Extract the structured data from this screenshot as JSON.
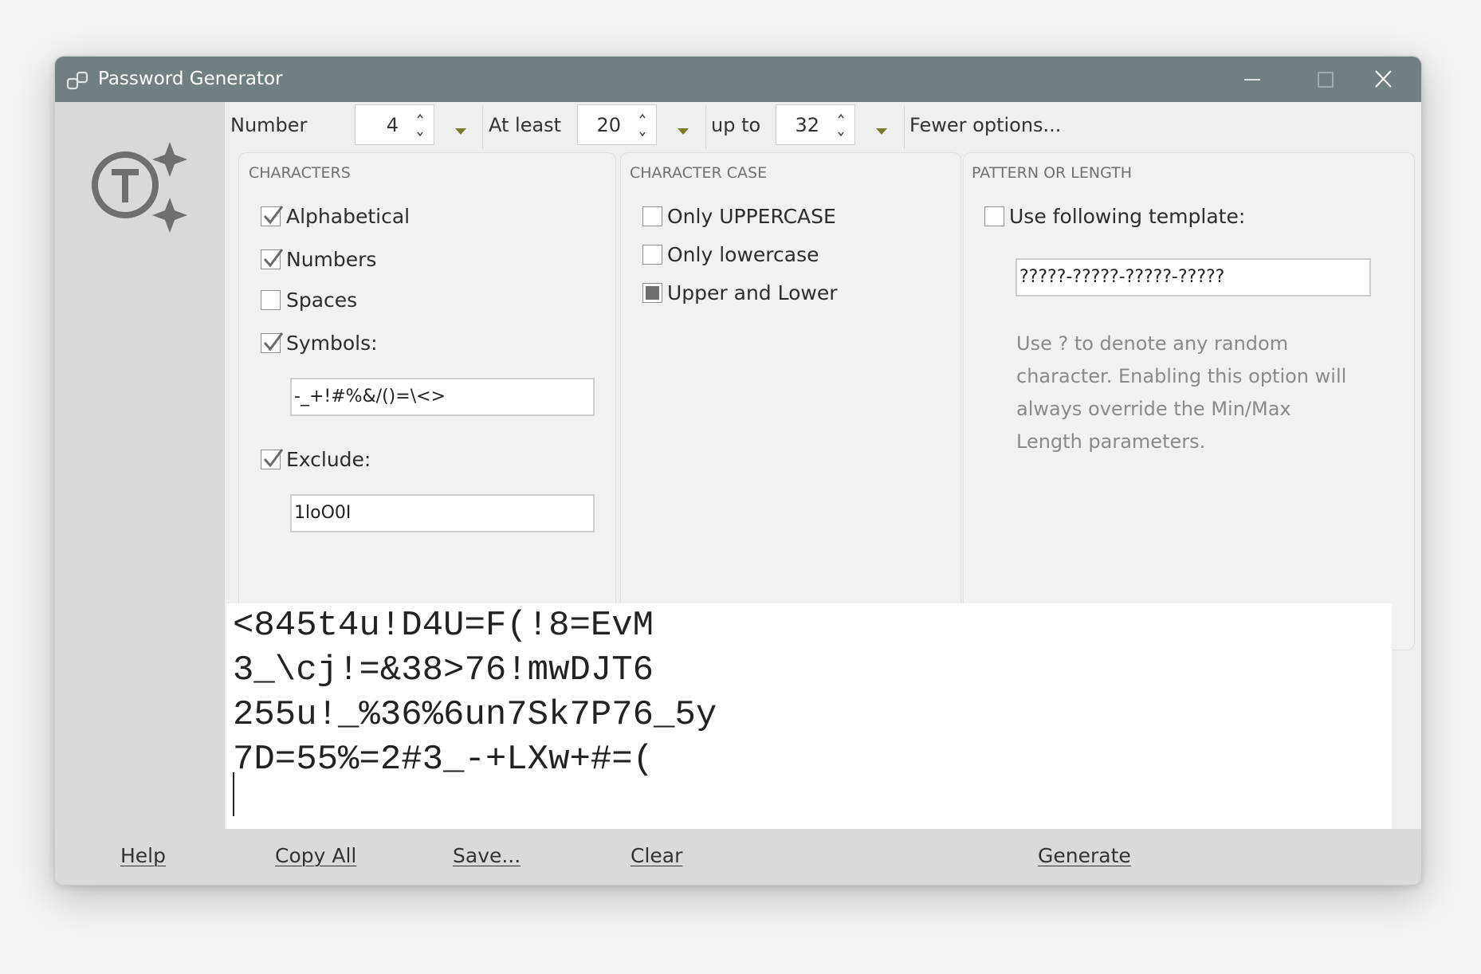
{
  "window": {
    "title": "Password Generator"
  },
  "toolbar": {
    "number_label": "Number",
    "number_value": "4",
    "at_least_label": "At least",
    "at_least_value": "20",
    "up_to_label": "up to",
    "up_to_value": "32",
    "fewer_options_label": "Fewer options..."
  },
  "characters": {
    "title": "CHARACTERS",
    "alphabetical": {
      "label": "Alphabetical",
      "checked": true
    },
    "numbers": {
      "label": "Numbers",
      "checked": true
    },
    "spaces": {
      "label": "Spaces",
      "checked": false
    },
    "symbols": {
      "label": "Symbols:",
      "checked": true,
      "value": "-_+!#%&/()=\\<>"
    },
    "exclude": {
      "label": "Exclude:",
      "checked": true,
      "value": "1loO0I"
    }
  },
  "character_case": {
    "title": "CHARACTER CASE",
    "only_uppercase": {
      "label": "Only UPPERCASE",
      "selected": false
    },
    "only_lowercase": {
      "label": "Only lowercase",
      "selected": false
    },
    "upper_and_lower": {
      "label": "Upper and Lower",
      "selected": true
    }
  },
  "pattern": {
    "title": "PATTERN OR LENGTH",
    "use_template": {
      "label": "Use following template:",
      "checked": false
    },
    "template_value": "?????-?????-?????-?????",
    "hint": "Use ? to denote any random character. Enabling this option will always override the Min/Max Length parameters."
  },
  "output": {
    "lines": [
      "<845t4u!D4U=F(!8=EvM",
      "3_\\cj!=&38>76!mwDJT6",
      "255u!_%36%6un7Sk7P76_5y",
      "7D=55%=2#3_-+LXw+#=("
    ]
  },
  "buttons": {
    "help": "Help",
    "copy_all": "Copy All",
    "save": "Save...",
    "clear": "Clear",
    "generate": "Generate"
  },
  "colors": {
    "titlebar": "#717f82",
    "sidebar": "#d9d9d9",
    "dropdown_arrow": "#7a7a2a"
  }
}
